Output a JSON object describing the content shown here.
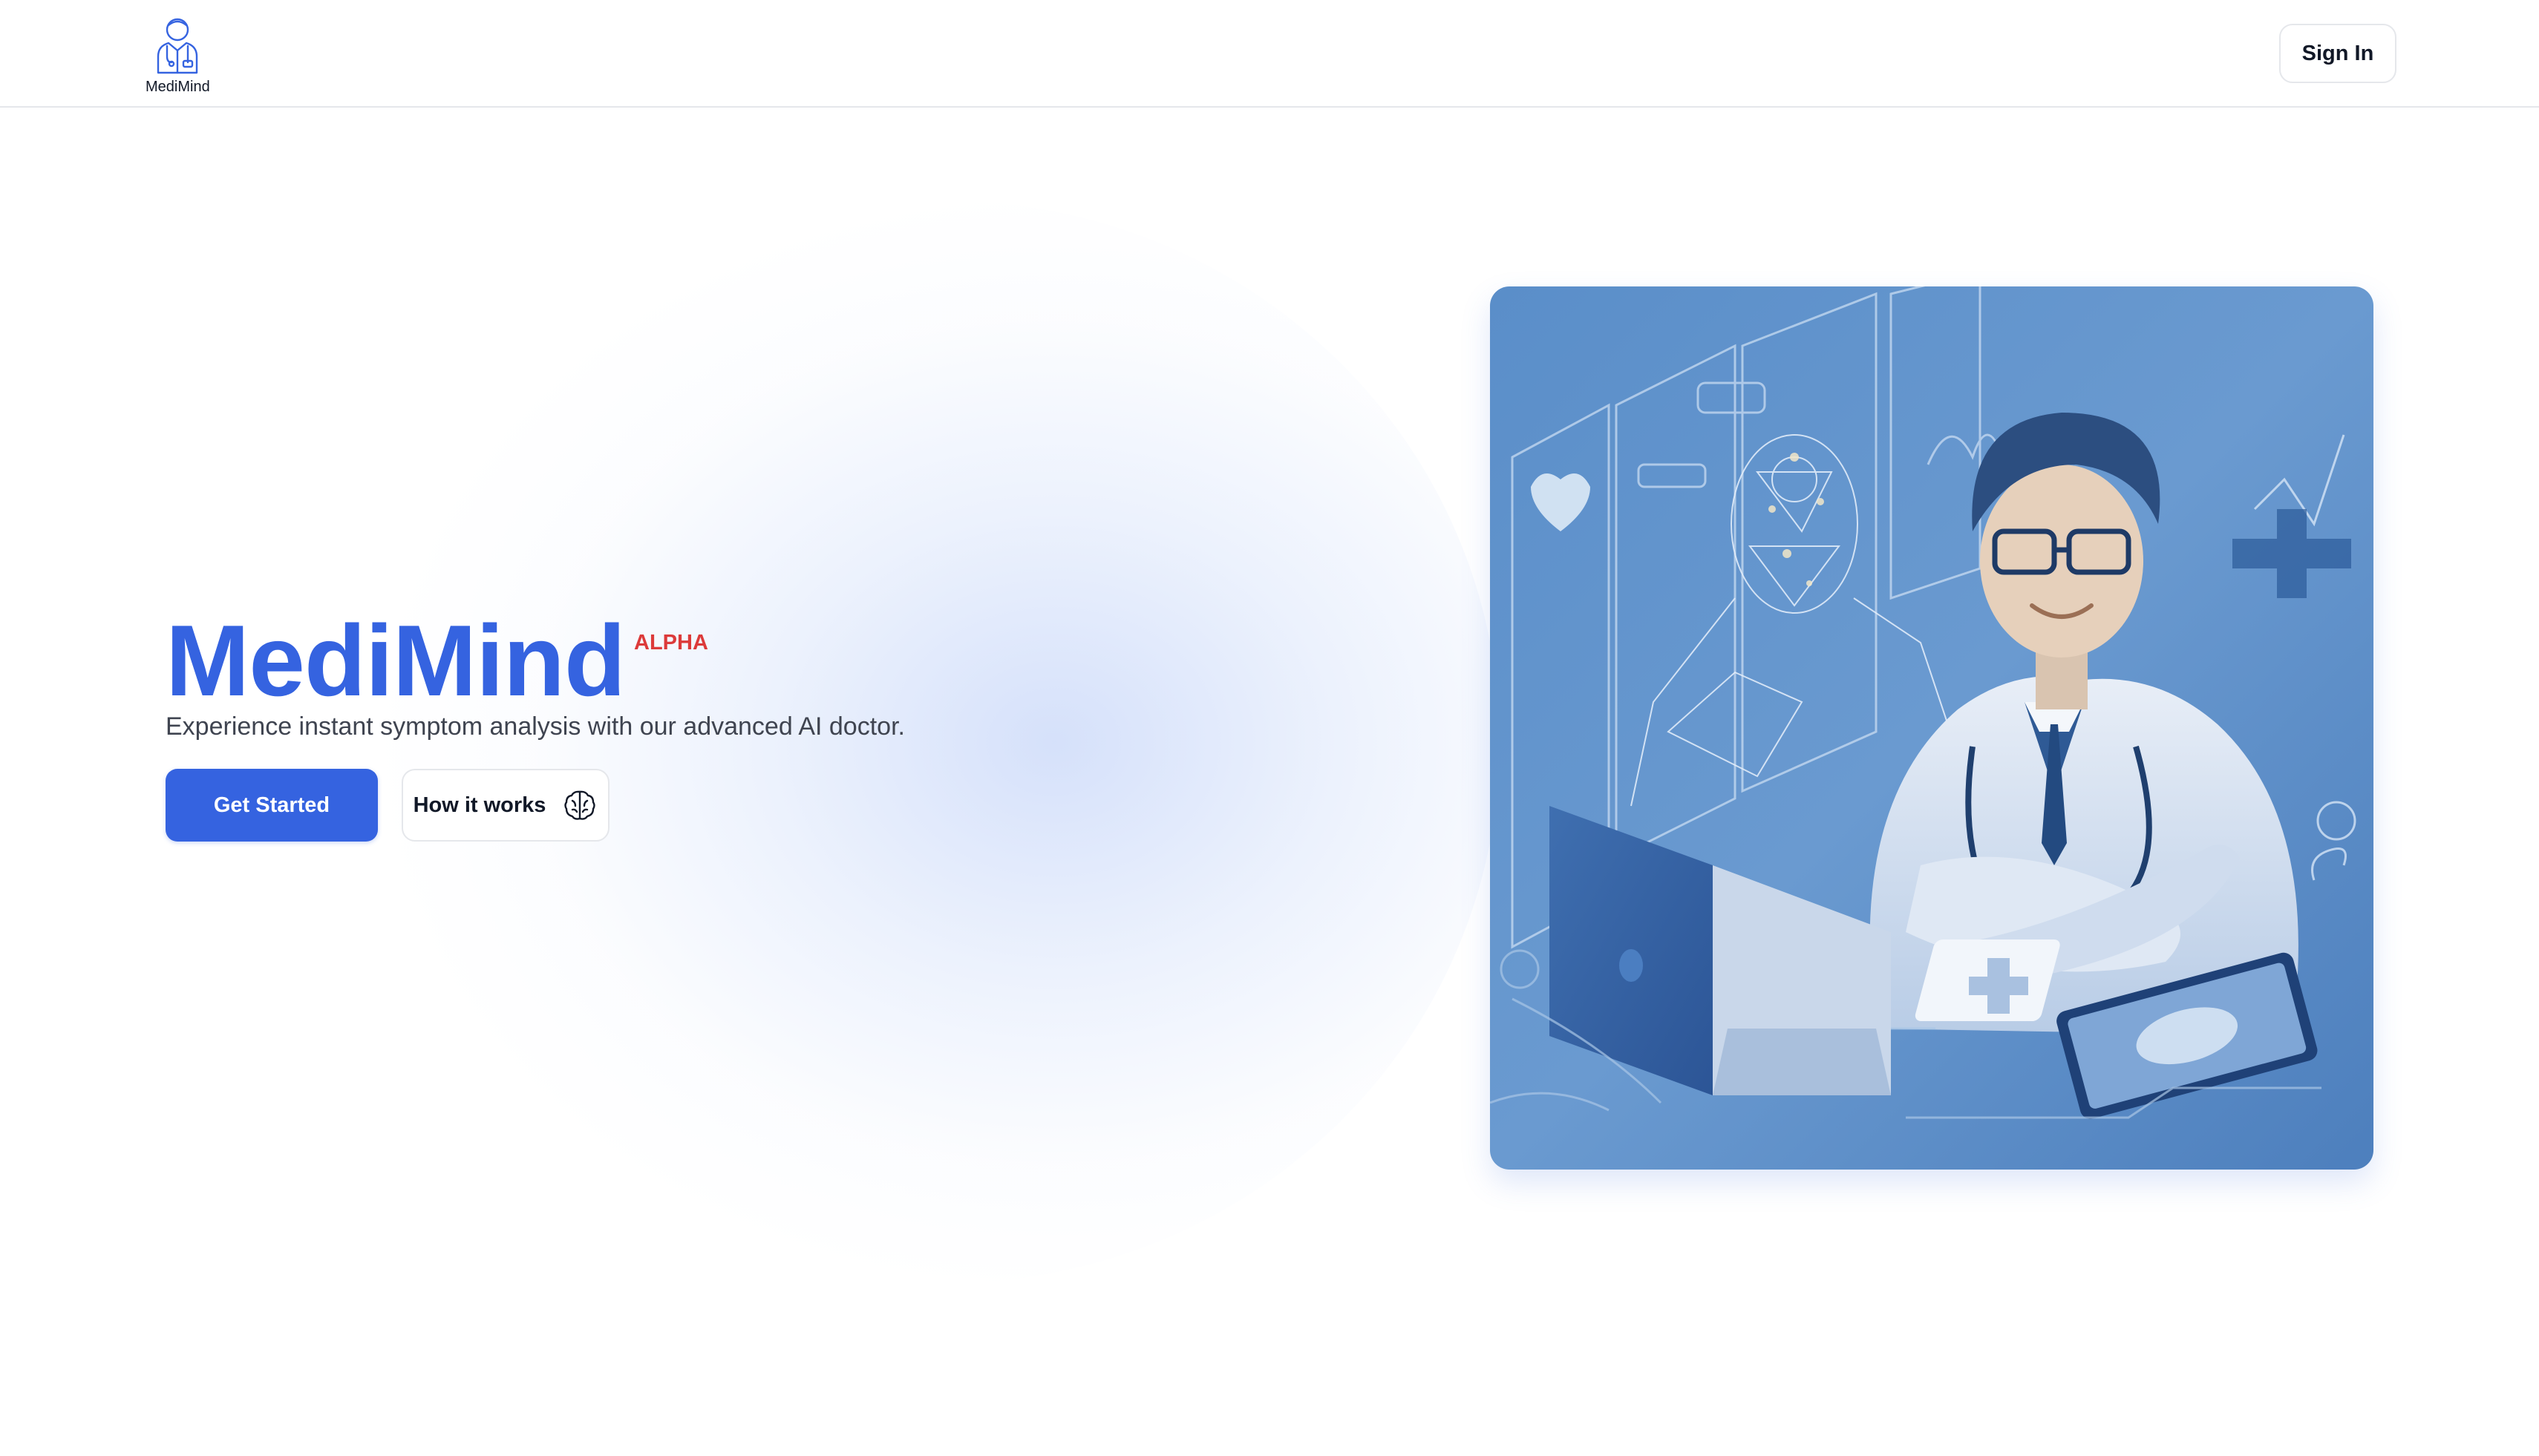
{
  "header": {
    "logo_label": "MediMind",
    "signin_label": "Sign In"
  },
  "hero": {
    "title": "MediMind",
    "badge": "ALPHA",
    "subtitle": "Experience instant symptom analysis with our advanced AI doctor.",
    "primary_label": "Get Started",
    "secondary_label": "How it works",
    "secondary_icon": "brain-icon"
  },
  "colors": {
    "accent": "#3563e0",
    "badge": "#dc3a3a",
    "illustration_bg": "#5d8cc4"
  }
}
